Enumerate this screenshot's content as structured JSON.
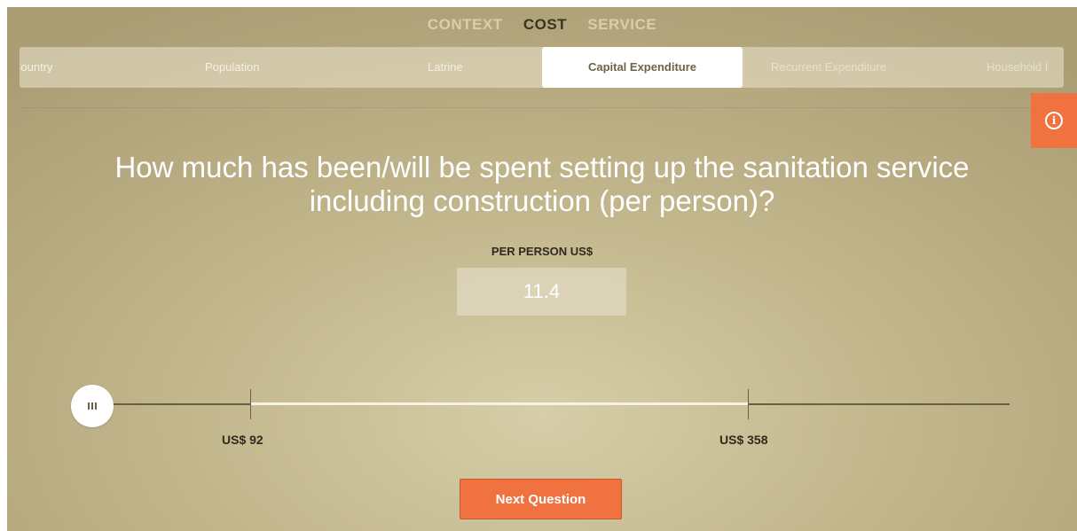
{
  "section_nav": [
    {
      "label": "CONTEXT",
      "active": false
    },
    {
      "label": "COST",
      "active": true
    },
    {
      "label": "SERVICE",
      "active": false
    }
  ],
  "tabs": [
    {
      "label": "Country"
    },
    {
      "label": "Population"
    },
    {
      "label": "Latrine"
    },
    {
      "label": "Capital Expenditure",
      "active": true
    },
    {
      "label": "Recurrent Expenditure"
    },
    {
      "label": "Household I"
    }
  ],
  "question": {
    "line1": "How much has been/will be spent setting up the sanitation service",
    "line2": "including construction (per person)?"
  },
  "input": {
    "label": "PER PERSON US$",
    "value": "11.4"
  },
  "slider": {
    "min_marker_label": "US$ 92",
    "max_marker_label": "US$ 358",
    "value": 11.4
  },
  "next_button": {
    "label": "Next Question"
  },
  "colors": {
    "accent": "#f07240",
    "background": "#c2b68c",
    "text_dark": "#2f2a1d"
  },
  "icons": {
    "info": "info-icon",
    "slider_thumb": "grip-icon"
  }
}
